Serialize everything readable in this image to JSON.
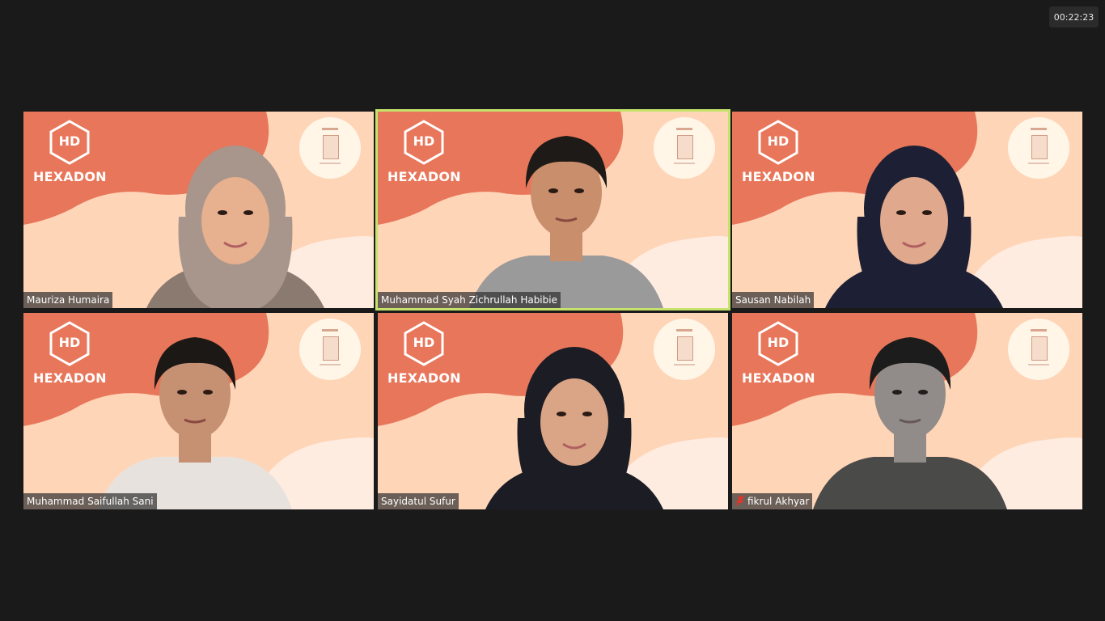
{
  "meeting": {
    "elapsed_time": "00:22:23"
  },
  "participants": [
    {
      "name": "Mauriza Humaira",
      "brand": "HEXADON",
      "logo": "HD",
      "muted": false,
      "active": false
    },
    {
      "name": "Muhammad Syah Zichrullah Habibie",
      "brand": "HEXADON",
      "logo": "HD",
      "muted": false,
      "active": true
    },
    {
      "name": "Sausan Nabilah",
      "brand": "HEXADON",
      "logo": "HD",
      "muted": false,
      "active": false
    },
    {
      "name": "Muhammad Saifullah Sani",
      "brand": "HEXADON",
      "logo": "HD",
      "muted": false,
      "active": false
    },
    {
      "name": "Sayidatul Sufur",
      "brand": "HEXADON",
      "logo": "HD",
      "muted": false,
      "active": false
    },
    {
      "name": "fikrul Akhyar",
      "brand": "HEXADON",
      "logo": "HD",
      "muted": true,
      "active": false
    }
  ],
  "colors": {
    "background": "#1a1a1a",
    "tile_light": "#ffd5b8",
    "blob": "#e8765a",
    "active_border": "#c6e36b",
    "mute_red": "#e0352b"
  },
  "icons": {
    "mute": "microphone-muted-icon",
    "logo": "hexagon-logo-icon"
  }
}
